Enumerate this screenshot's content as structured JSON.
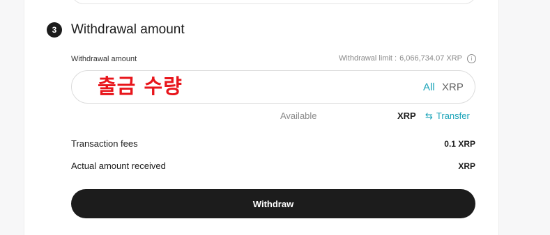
{
  "step": {
    "number": "3",
    "title": "Withdrawal amount"
  },
  "amount_field": {
    "label": "Withdrawal amount",
    "limit_label": "Withdrawal limit :",
    "limit_value": "6,066,734.07 XRP",
    "info_icon": "ⓘ",
    "placeholder": "출금 수량",
    "all_label": "All",
    "unit": "XRP"
  },
  "available": {
    "label": "Available",
    "unit": "XRP",
    "transfer_label": "Transfer",
    "transfer_icon": "⇆"
  },
  "fees": {
    "label": "Transaction fees",
    "value": "0.1 XRP"
  },
  "received": {
    "label": "Actual amount received",
    "value": "XRP"
  },
  "actions": {
    "withdraw_label": "Withdraw"
  },
  "colors": {
    "accent": "#1aa3b8",
    "button": "#1c1c1c",
    "placeholder_overlay": "#e8151b"
  }
}
